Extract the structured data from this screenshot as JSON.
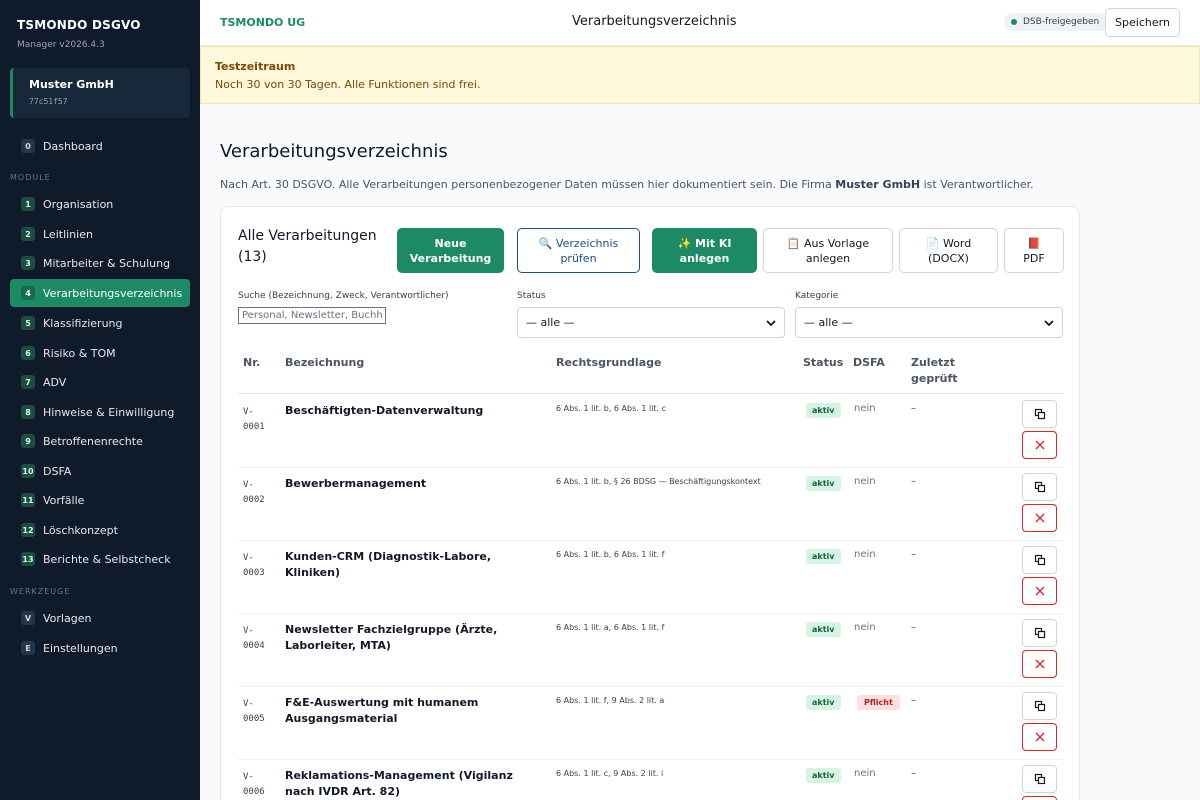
{
  "brand": {
    "title": "TSMONDO DSGVO",
    "version": "Manager v2026.4.3"
  },
  "org": {
    "name": "Muster GmbH",
    "id": "77c51f57"
  },
  "sidebar": {
    "items": [
      {
        "num": "0",
        "label": "Dashboard"
      },
      {
        "num": "1",
        "label": "Organisation"
      },
      {
        "num": "2",
        "label": "Leitlinien"
      },
      {
        "num": "3",
        "label": "Mitarbeiter & Schulung"
      },
      {
        "num": "4",
        "label": "Verarbeitungsverzeichnis"
      },
      {
        "num": "5",
        "label": "Klassifizierung"
      },
      {
        "num": "6",
        "label": "Risiko & TOM"
      },
      {
        "num": "7",
        "label": "ADV"
      },
      {
        "num": "8",
        "label": "Hinweise & Einwilligung"
      },
      {
        "num": "9",
        "label": "Betroffenenrechte"
      },
      {
        "num": "10",
        "label": "DSFA"
      },
      {
        "num": "11",
        "label": "Vorfälle"
      },
      {
        "num": "12",
        "label": "Löschkonzept"
      },
      {
        "num": "13",
        "label": "Berichte & Selbstcheck"
      }
    ],
    "section_module": "MODULE",
    "section_tools": "WERKZEUGE",
    "tools": [
      {
        "num": "V",
        "label": "Vorlagen"
      },
      {
        "num": "E",
        "label": "Einstellungen"
      }
    ]
  },
  "header": {
    "company": "TSMONDO UG",
    "title": "Verarbeitungsverzeichnis",
    "badge": "DSB-freigegeben",
    "save_label": "Speichern"
  },
  "trial": {
    "title": "Testzeitraum",
    "text": "Noch 30 von 30 Tagen. Alle Funktionen sind frei."
  },
  "page": {
    "title": "Verarbeitungsverzeichnis",
    "desc_prefix": "Nach Art. 30 DSGVO. Alle Verarbeitungen personenbezogener Daten müssen hier dokumentiert sein. Die Firma",
    "desc_company": "Muster GmbH",
    "desc_suffix": "ist Verantwortlicher."
  },
  "card": {
    "title": "Alle Verarbeitungen (13)",
    "actions": {
      "new": "Neue Verarbeitung",
      "check": "🔍 Verzeichnis prüfen",
      "ai": "✨ Mit KI anlegen",
      "template": "📋 Aus Vorlage anlegen",
      "word": "📄 Word (DOCX)",
      "pdf": "📕 PDF"
    },
    "filters": {
      "search_label": "Suche (Bezeichnung, Zweck, Verantwortlicher)",
      "search_placeholder": "Personal, Newsletter, Buchhaltung …",
      "status_label": "Status",
      "status_value": "— alle —",
      "category_label": "Kategorie",
      "category_value": "— alle —"
    },
    "columns": {
      "nr": "Nr.",
      "name": "Bezeichnung",
      "law": "Rechtsgrundlage",
      "status": "Status",
      "dsfa": "DSFA",
      "last": "Zuletzt geprüft"
    },
    "rows": [
      {
        "nr": "V-0001",
        "name": "Beschäftigten-Datenverwaltung",
        "law": "6 Abs. 1 lit. b, 6 Abs. 1 lit. c",
        "status": "aktiv",
        "dsfa": "nein",
        "last": "–"
      },
      {
        "nr": "V-0002",
        "name": "Bewerbermanagement",
        "law": "6 Abs. 1 lit. b, § 26 BDSG — Beschäftigungskontext",
        "status": "aktiv",
        "dsfa": "nein",
        "last": "–"
      },
      {
        "nr": "V-0003",
        "name": "Kunden-CRM (Diagnostik-Labore, Kliniken)",
        "law": "6 Abs. 1 lit. b, 6 Abs. 1 lit. f",
        "status": "aktiv",
        "dsfa": "nein",
        "last": "–"
      },
      {
        "nr": "V-0004",
        "name": "Newsletter Fachzielgruppe (Ärzte, Laborleiter, MTA)",
        "law": "6 Abs. 1 lit. a, 6 Abs. 1 lit. f",
        "status": "aktiv",
        "dsfa": "nein",
        "last": "–"
      },
      {
        "nr": "V-0005",
        "name": "F&E-Auswertung mit humanem Ausgangsmaterial",
        "law": "6 Abs. 1 lit. f, 9 Abs. 2 lit. a",
        "status": "aktiv",
        "dsfa": "Pflicht",
        "last": "–"
      },
      {
        "nr": "V-0006",
        "name": "Reklamations-Management (Vigilanz nach IVDR Art. 82)",
        "law": "6 Abs. 1 lit. c, 9 Abs. 2 lit. i",
        "status": "aktiv",
        "dsfa": "nein",
        "last": "–"
      }
    ]
  },
  "colors": {
    "accent": "#1c8a64",
    "sidebar_bg": "#0f1b2a",
    "danger": "#dc2626"
  }
}
